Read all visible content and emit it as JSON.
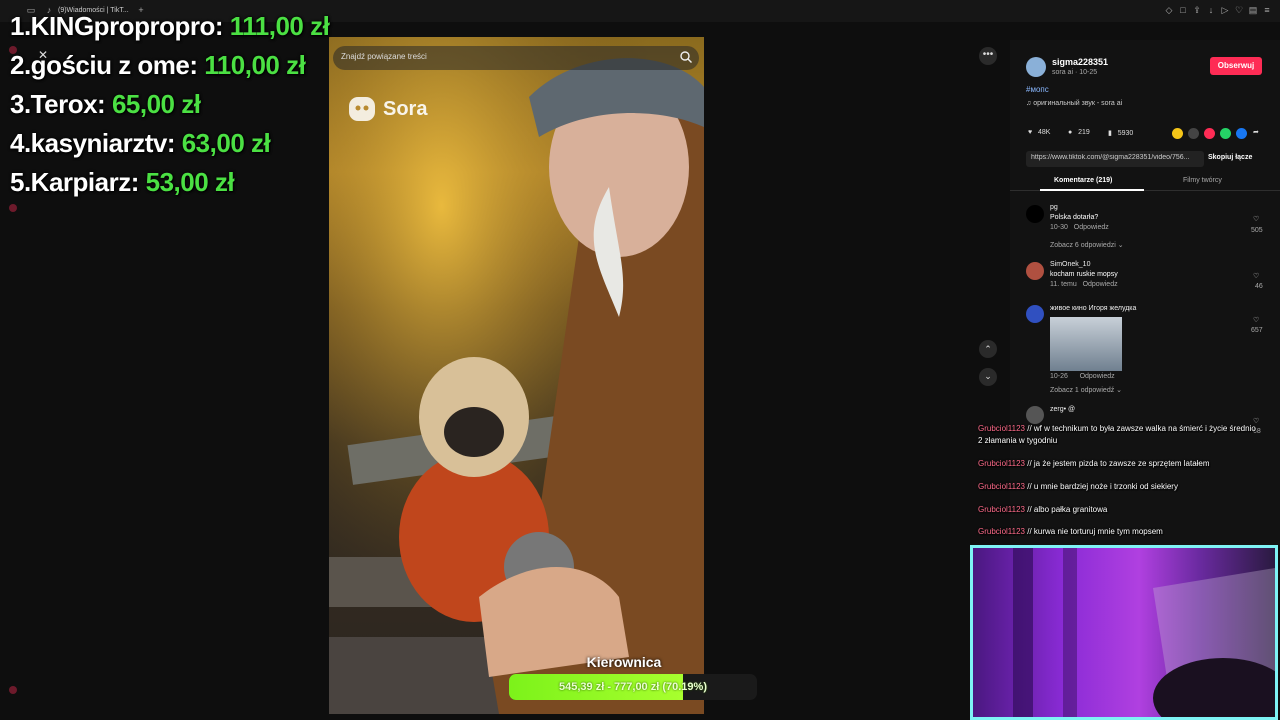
{
  "browser": {
    "tab_title": "(9)Wiadomości | TikT..."
  },
  "leaderboard": [
    {
      "name": "1.KINGpropropro:",
      "amount": "111,00 zł"
    },
    {
      "name": "2.gościu z ome:",
      "amount": "110,00 zł"
    },
    {
      "name": "3.Terox:",
      "amount": "65,00 zł"
    },
    {
      "name": "4.kasyniarztv:",
      "amount": "63,00 zł"
    },
    {
      "name": "5.Karpiarz:",
      "amount": "53,00 zł"
    }
  ],
  "video": {
    "search_placeholder": "Znajdź powiązane treści",
    "watermark": "Sora"
  },
  "post": {
    "username": "sigma228351",
    "subtitle": "sora ai · 10-25",
    "follow_label": "Obserwuj",
    "hashtag": "#мопс",
    "sound": "оригинальный звук - sora ai",
    "likes": "48K",
    "comments": "219",
    "saves": "5930",
    "link": "https://www.tiktok.com/@sigma228351/video/756...",
    "copy_label": "Skopiuj łącze",
    "tab_comments": "Komentarze (219)",
    "tab_videos": "Filmy twórcy"
  },
  "comments": [
    {
      "user": "pg",
      "text": "Polska dotarła?",
      "meta": "10-30",
      "reply": "Odpowiedz",
      "likes": "505",
      "more": "Zobacz 6 odpowiedzi"
    },
    {
      "user": "SimOnek_10",
      "text": "kocham ruskie mopsy",
      "meta": "11. temu",
      "reply": "Odpowiedz",
      "likes": "46"
    },
    {
      "user": "живое кино Игоря желудка",
      "text": "",
      "meta": "10-26",
      "reply": "Odpowiedz",
      "likes": "657",
      "more": "Zobacz 1 odpowiedź"
    },
    {
      "user": "zerg• @",
      "text": "",
      "likes": "68"
    }
  ],
  "chat": [
    {
      "user": "Grubciol1123",
      "text": "wf w technikum to była zawsze walka na śmierć i życie średnio 2 złamania w tygodniu"
    },
    {
      "user": "Grubciol1123",
      "text": "ja że jestem pizda to zawsze ze sprzętem latałem"
    },
    {
      "user": "Grubciol1123",
      "text": "u mnie bardziej noże i trzonki od siekiery"
    },
    {
      "user": "Grubciol1123",
      "text": "albo pałka granitowa"
    },
    {
      "user": "Grubciol1123",
      "text": "kurwa nie torturuj mnie tym mopsem"
    }
  ],
  "goal": {
    "title": "Kierownica",
    "text": "545,39 zł - 777,00 zł (70.19%)",
    "progress": 0.7019
  },
  "colors": {
    "amount_green": "#4be043",
    "follow_red": "#fe2c55",
    "goal_green": "#8cf020",
    "cam_border": "#7ef3f5"
  }
}
